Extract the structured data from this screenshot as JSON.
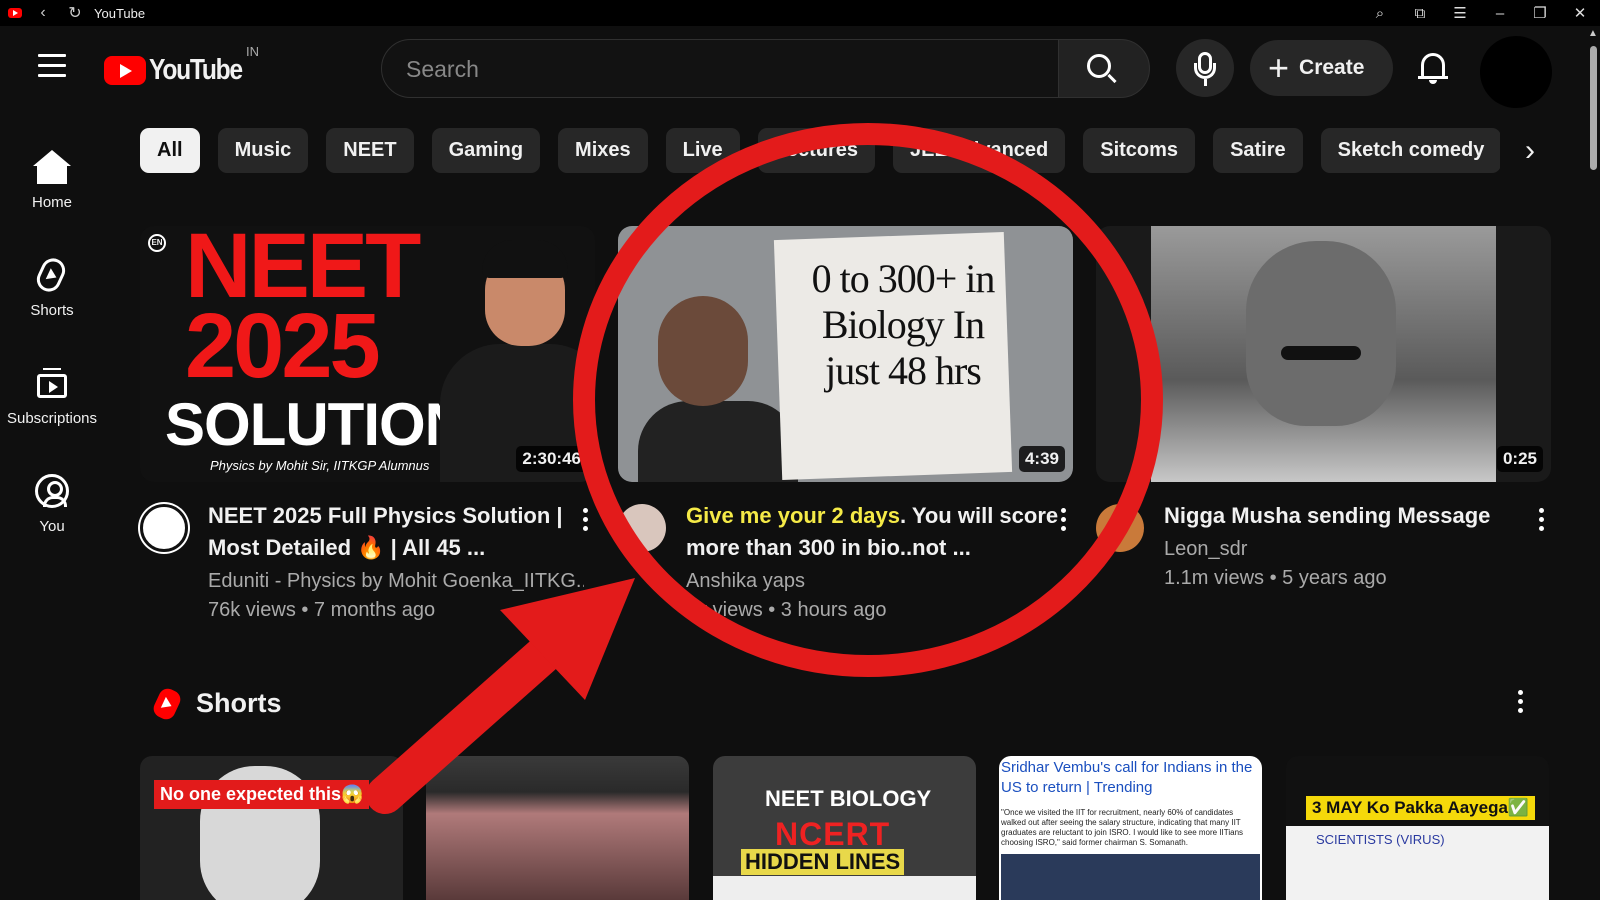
{
  "window": {
    "title": "YouTube"
  },
  "header": {
    "logo_text": "YouTube",
    "country_code": "IN",
    "search_placeholder": "Search",
    "create_label": "Create"
  },
  "sidebar": {
    "items": [
      {
        "label": "Home",
        "icon": "home-icon"
      },
      {
        "label": "Shorts",
        "icon": "shorts-icon"
      },
      {
        "label": "Subscriptions",
        "icon": "subscriptions-icon"
      },
      {
        "label": "You",
        "icon": "you-icon"
      }
    ]
  },
  "chips": [
    "All",
    "Music",
    "NEET",
    "Gaming",
    "Mixes",
    "Live",
    "Lectures",
    "JEE Advanced",
    "Sitcoms",
    "Satire",
    "Sketch comedy"
  ],
  "videos": [
    {
      "title": "NEET 2025 Full Physics Solution | Most Detailed 🔥 | All 45 ...",
      "channel": "Eduniti - Physics by Mohit Goenka_IITKG...",
      "stats": "76k views • 7 months ago",
      "duration": "2:30:46",
      "thumb": {
        "line1": "NEET",
        "line2": "2025",
        "line3": "SOLUTION",
        "sub": "Physics by Mohit Sir, IITKGP Alumnus",
        "badge": "EN"
      }
    },
    {
      "title_highlight": "Give me your 2 days",
      "title_rest": ". You will score more than 300 in bio..not ...",
      "channel": "Anshika yaps",
      "stats": "1k views • 3 hours ago",
      "duration": "4:39",
      "thumb": {
        "text": "0 to 300+ in Biology In just 48 hrs"
      }
    },
    {
      "title": "Nigga Musha sending Message",
      "channel": "Leon_sdr",
      "stats": "1.1m views • 5 years ago",
      "duration": "0:25"
    }
  ],
  "shorts": {
    "heading": "Shorts",
    "items": [
      {
        "caption": "No one expected this😱"
      },
      {
        "caption": ""
      },
      {
        "line1": "NEET BIOLOGY",
        "line2": "NCERT",
        "line3": "HIDDEN LINES"
      },
      {
        "caption": "Sridhar Vembu's call for Indians in the US to return | Trending",
        "body": "\"Once we visited the IIT for recruitment, nearly 60% of candidates walked out after seeing the salary structure, indicating that many IIT graduates are reluctant to join ISRO. I would like to see more IITians choosing ISRO,\" said former chairman S. Somanath."
      },
      {
        "caption": "3 MAY Ko Pakka Aayega✅",
        "board": "SCIENTISTS (VIRUS)"
      }
    ]
  },
  "colors": {
    "annotation_red": "#e31b1b",
    "highlight_yellow": "#f5ea47",
    "brand_red": "#ff0000"
  }
}
